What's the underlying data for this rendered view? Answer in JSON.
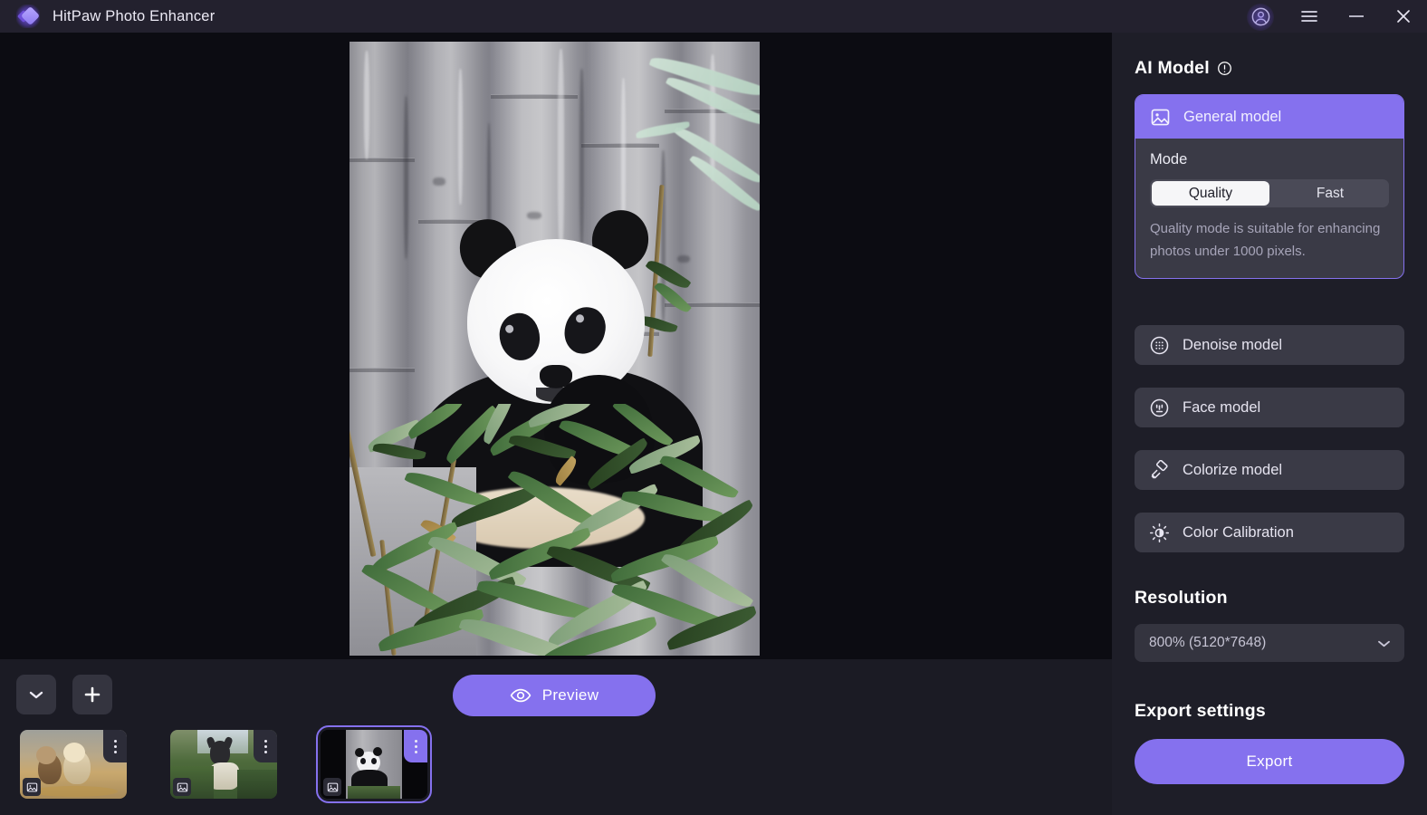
{
  "app": {
    "title": "HitPaw Photo Enhancer",
    "logo_icon": "hitpaw-diamond-logo",
    "accent_color": "#8571ee",
    "panel_bg": "#1e1e28",
    "row_bg": "#3a3a46",
    "canvas_bg": "#0c0c12",
    "titlebar_bg": "#23212e"
  },
  "titlebar": {
    "account_icon": "account-avatar-icon",
    "menu_icon": "hamburger-menu-icon",
    "minimize_icon": "minimize-icon",
    "close_icon": "close-icon"
  },
  "canvas": {
    "image_description": "Giant panda sitting among green bamboo leaves in front of grey bamboo stalks",
    "orientation": "portrait"
  },
  "bottom_bar": {
    "collapse_icon": "chevron-down-icon",
    "add_icon": "plus-icon",
    "preview": {
      "label": "Preview",
      "icon": "eye-icon"
    },
    "thumbnails": [
      {
        "name": "thumbnail-puppies",
        "description": "Two puppies on golden grass",
        "selected": false,
        "menu_icon": "more-vertical-icon",
        "badge_icon": "image-file-icon"
      },
      {
        "name": "thumbnail-cat",
        "description": "Cat sitting in green grass",
        "selected": false,
        "menu_icon": "more-vertical-icon",
        "badge_icon": "image-file-icon"
      },
      {
        "name": "thumbnail-panda",
        "description": "Panda in bamboo forest",
        "selected": true,
        "menu_icon": "more-vertical-icon",
        "badge_icon": "image-file-icon"
      }
    ]
  },
  "panel": {
    "ai_model": {
      "heading": "AI Model",
      "info_icon": "info-circle-icon"
    },
    "general_model": {
      "label": "General model",
      "icon": "image-picture-icon",
      "selected": true,
      "mode_label": "Mode",
      "modes": [
        {
          "label": "Quality",
          "selected": true
        },
        {
          "label": "Fast",
          "selected": false
        }
      ],
      "description": "Quality mode is suitable for enhancing photos under 1000 pixels."
    },
    "models": [
      {
        "label": "Denoise model",
        "icon": "denoise-dots-circle-icon",
        "name": "denoise-model"
      },
      {
        "label": "Face model",
        "icon": "face-circle-icon",
        "name": "face-model"
      },
      {
        "label": "Colorize model",
        "icon": "paint-roller-icon",
        "name": "colorize-model"
      },
      {
        "label": "Color Calibration",
        "icon": "brightness-sun-icon",
        "name": "color-calibration"
      }
    ],
    "resolution": {
      "heading": "Resolution",
      "value": "800% (5120*7648)",
      "chevron_icon": "chevron-down-icon"
    },
    "export": {
      "heading": "Export settings",
      "button_label": "Export"
    }
  }
}
